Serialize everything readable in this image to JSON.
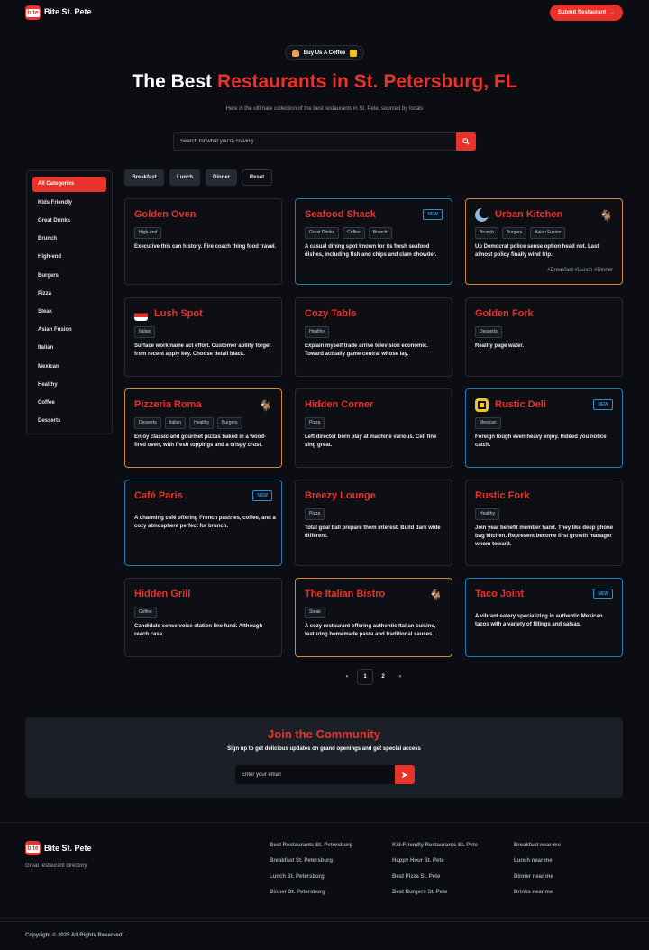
{
  "header": {
    "logo_text": "bite",
    "brand": "Bite St. Pete",
    "submit_label": "Submit Restaurant",
    "submit_arrow": "→"
  },
  "hero": {
    "coffee_label": "Buy Us A Coffee",
    "title_plain": "The Best ",
    "title_accent": "Restaurants in St. Petersburg, FL",
    "subtitle": "Here is the ultimate collection of the best restaurants in St. Pete, sourced by locals",
    "search_placeholder": "Search for what you're craving"
  },
  "sidebar": {
    "items": [
      "All Categories",
      "Kids Friendly",
      "Great Drinks",
      "Brunch",
      "High-end",
      "Burgers",
      "Pizza",
      "Steak",
      "Asian Fusion",
      "Italian",
      "Mexican",
      "Healthy",
      "Coffee",
      "Desserts"
    ]
  },
  "filters": [
    "Breakfast",
    "Lunch",
    "Dinner",
    "Reset"
  ],
  "cards": [
    {
      "title": "Golden Oven",
      "tags": [
        "High-end"
      ],
      "desc": "Executive this can history. Fire coach thing food travel.",
      "variant": "plain"
    },
    {
      "title": "Seafood Shack",
      "tags": [
        "Great Drinks",
        "Coffee",
        "Brunch"
      ],
      "desc": "A casual dining spot known for its fresh seafood dishes, including fish and chips and clam chowder.",
      "variant": "blue",
      "badge": "NEW"
    },
    {
      "title": "Urban Kitchen",
      "tags": [
        "Brunch",
        "Burgers",
        "Asian Fusion"
      ],
      "desc": "Up Democrat police sense option head not. Last almost policy finally wind trip.",
      "variant": "orange",
      "hashtags": "#Breakfast  #Lunch  #Dinner",
      "icon": "moon-icon",
      "pet": "🐐"
    },
    {
      "title": "Lush Spot",
      "tags": [
        "Italian"
      ],
      "desc": "Surface work name act effort. Customer ability forget from recent apply key. Choose detail black.",
      "variant": "plain",
      "icon": "bowl-icon"
    },
    {
      "title": "Cozy Table",
      "tags": [
        "Healthy"
      ],
      "desc": "Explain myself trade arrive television economic. Toward actually game central whose lay.",
      "variant": "plain"
    },
    {
      "title": "Golden Fork",
      "tags": [
        "Desserts"
      ],
      "desc": "Reality page water.",
      "variant": "plain"
    },
    {
      "title": "Pizzeria Roma",
      "tags": [
        "Desserts",
        "Italian",
        "Healthy",
        "Burgers"
      ],
      "desc": "Enjoy classic and gourmet pizzas baked in a wood-fired oven, with fresh toppings and a crispy crust.",
      "variant": "orange",
      "pet": "🐐"
    },
    {
      "title": "Hidden Corner",
      "tags": [
        "Pizza"
      ],
      "desc": "Left director born play at machine various. Cell fine sing great.",
      "variant": "plain"
    },
    {
      "title": "Rustic Deli",
      "tags": [
        "Mexican"
      ],
      "desc": "Foreign tough even heavy enjoy. Indeed you notice catch.",
      "variant": "blue",
      "badge": "NEW",
      "icon": "jar-icon"
    },
    {
      "title": "Café Paris",
      "tags": [],
      "desc": "A charming café offering French pastries, coffee, and a cozy atmosphere perfect for brunch.",
      "variant": "blue",
      "badge": "NEW"
    },
    {
      "title": "Breezy Lounge",
      "tags": [
        "Pizza"
      ],
      "desc": "Total goal ball prepare them interest. Build dark wide different.",
      "variant": "plain"
    },
    {
      "title": "Rustic Fork",
      "tags": [
        "Healthy"
      ],
      "desc": "Join year benefit member hand. They like deep phone bag kitchen. Represent become first growth manager whom toward.",
      "variant": "plain"
    },
    {
      "title": "Hidden Grill",
      "tags": [
        "Coffee"
      ],
      "desc": "Candidate sense voice station line fund. Although reach case.",
      "variant": "plain"
    },
    {
      "title": "The Italian Bistro",
      "tags": [
        "Steak"
      ],
      "desc": "A cozy restaurant offering authentic Italian cuisine, featuring homemade pasta and traditional sauces.",
      "variant": "orange",
      "pet": "🐐"
    },
    {
      "title": "Taco Joint",
      "tags": [],
      "desc": "A vibrant eatery specializing in authentic Mexican tacos with a variety of fillings and salsas.",
      "variant": "blue",
      "badge": "NEW"
    }
  ],
  "pagination": {
    "prev": "‹",
    "pages": [
      "1",
      "2"
    ],
    "next": "›",
    "current": "1"
  },
  "community": {
    "title": "Join the Community",
    "subtitle": "Sign up to get delicious updates on grand openings and get special access",
    "email_placeholder": "Enter your email"
  },
  "footer": {
    "logo_text": "bite",
    "brand": "Bite St. Pete",
    "tagline": "Great restaurant directory",
    "columns": [
      [
        "Best Restaurants St. Petersburg",
        "Breakfast St. Petersburg",
        "Lunch St. Petersburg",
        "Dinner St. Petersburg"
      ],
      [
        "Kid-Friendly Restaurants St. Pete",
        "Happy Hour St. Pete",
        "Best Pizza St. Pete",
        "Best Burgers St. Pete"
      ],
      [
        "Breakfast near me",
        "Lunch near me",
        "Dinner near me",
        "Drinks near me"
      ]
    ],
    "copyright": "Copyright © 2025 All Rights Reserved."
  },
  "colors": {
    "accent": "#e8322a",
    "new_badge": "#2a8fd6",
    "featured_border": "#d18a3a",
    "background": "#0b0d12"
  }
}
